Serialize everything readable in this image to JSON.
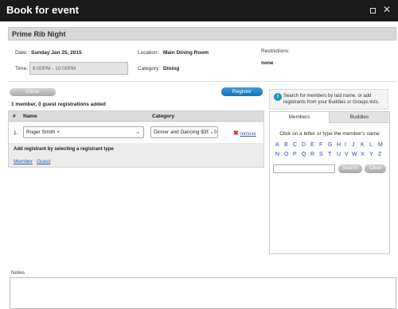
{
  "window": {
    "title": "Book for event"
  },
  "event": {
    "name": "Prime Rib Night",
    "date_label": "Date:",
    "date_value": "Sunday Jan 25, 2015",
    "time_label": "Time:",
    "time_value": "6:00PM - 10:00PM",
    "location_label": "Location:",
    "location_value": "Main Dining Room",
    "category_label": "Category:",
    "category_value": "Dining",
    "restrictions_label": "Restrictions:",
    "restrictions_value": "none"
  },
  "actions": {
    "close_label": "Close",
    "register_label": "Register"
  },
  "registrations": {
    "summary": "1 member, 0 guest registrations added",
    "columns": {
      "num": "#",
      "name": "Name",
      "category": "Category"
    },
    "rows": [
      {
        "num": "1.",
        "name": "Roger Smith",
        "remove_tag": "×",
        "category": "Dinner and Dancing $35.00",
        "remove_label": "remove"
      }
    ],
    "add_label": "Add registrant by selecting a registrant type",
    "types": {
      "member": "Member",
      "guest": "Guest"
    }
  },
  "search_panel": {
    "hint": "Search for members by last name, or add registrants from your Buddies or Groups lists.",
    "tabs": {
      "members": "Members",
      "buddies": "Buddies"
    },
    "instruction": "Click on a letter or type the member's name",
    "letters": [
      "A",
      "B",
      "C",
      "D",
      "E",
      "F",
      "G",
      "H",
      "I",
      "J",
      "K",
      "L",
      "M",
      "N",
      "O",
      "P",
      "Q",
      "R",
      "S",
      "T",
      "U",
      "V",
      "W",
      "X",
      "Y",
      "Z"
    ],
    "search_label": "Search",
    "clear_label": "Clear"
  },
  "notes": {
    "label": "Notes"
  },
  "icons": {
    "info": "info-icon",
    "remove": "remove-x-icon",
    "maximize": "maximize-icon",
    "close": "close-icon",
    "dropdown": "chevron-down-icon"
  },
  "colors": {
    "titlebar": "#1a1a1a",
    "accent": "#1a6fb4",
    "link": "#2b5ea8",
    "remove_icon": "#dd2222"
  }
}
